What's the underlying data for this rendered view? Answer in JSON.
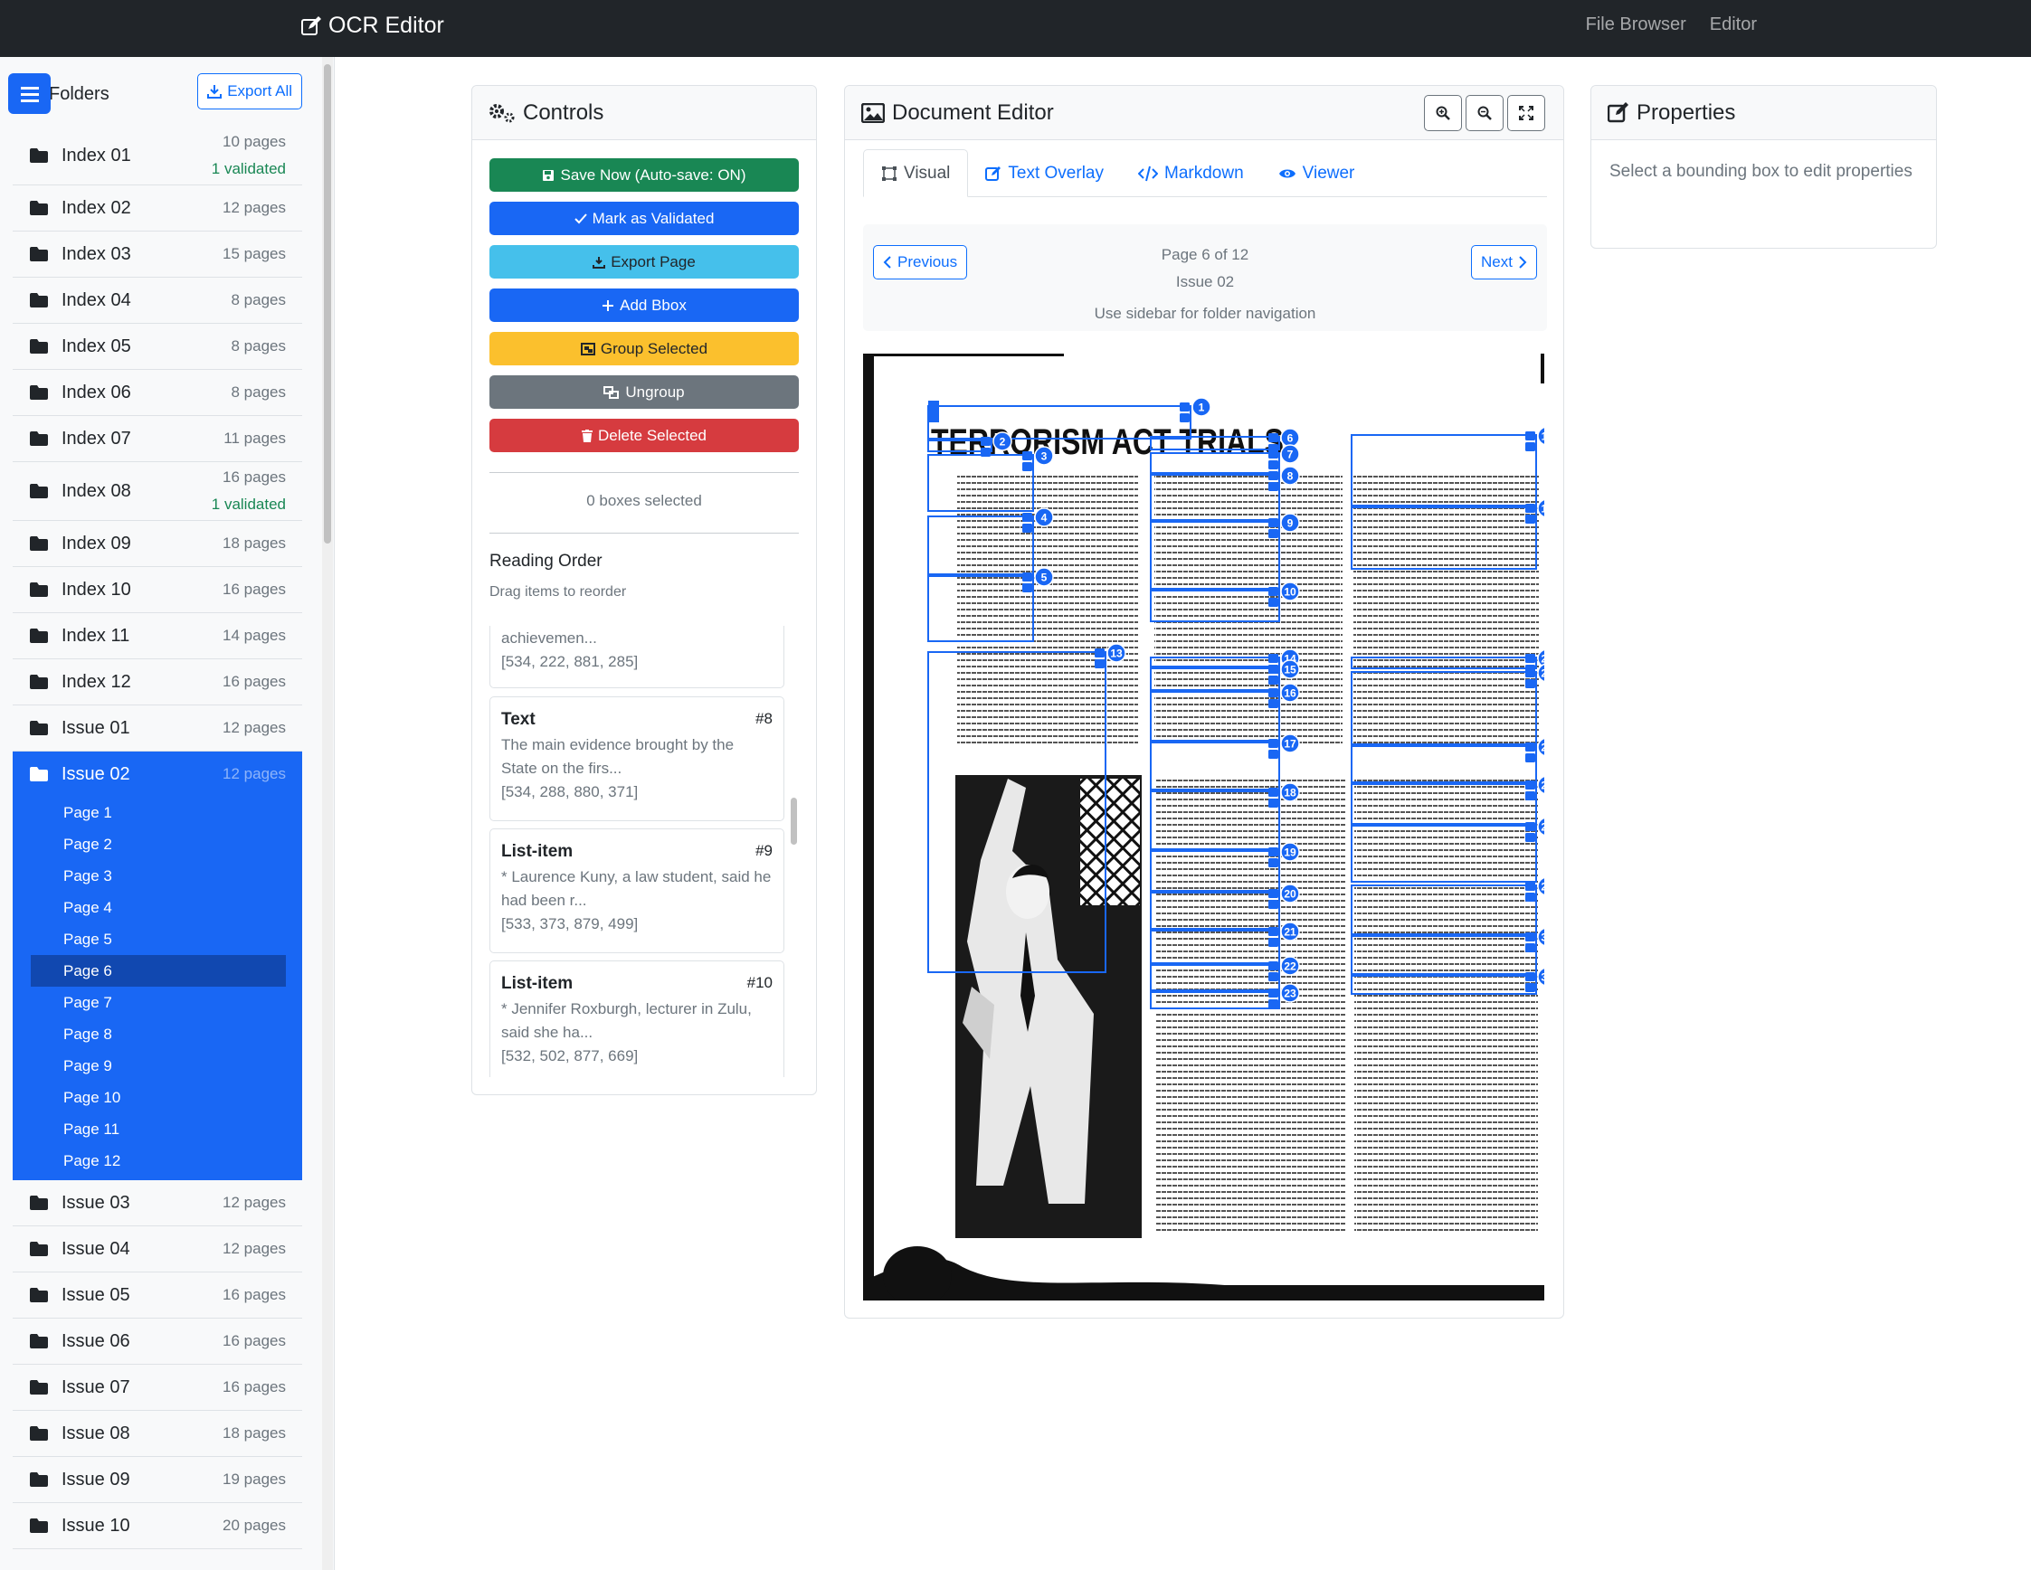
{
  "navbar": {
    "brand": "OCR Editor",
    "links": [
      "File Browser",
      "Editor"
    ]
  },
  "sidebar": {
    "title": "Folders",
    "export_all": "Export All",
    "folders_top": [
      {
        "name": "Index 01",
        "pages": "10 pages",
        "validated": "1 validated"
      },
      {
        "name": "Index 02",
        "pages": "12 pages"
      },
      {
        "name": "Index 03",
        "pages": "15 pages"
      },
      {
        "name": "Index 04",
        "pages": "8 pages"
      },
      {
        "name": "Index 05",
        "pages": "8 pages"
      },
      {
        "name": "Index 06",
        "pages": "8 pages"
      },
      {
        "name": "Index 07",
        "pages": "11 pages"
      },
      {
        "name": "Index 08",
        "pages": "16 pages",
        "validated": "1 validated"
      },
      {
        "name": "Index 09",
        "pages": "18 pages"
      },
      {
        "name": "Index 10",
        "pages": "16 pages"
      },
      {
        "name": "Index 11",
        "pages": "14 pages"
      },
      {
        "name": "Index 12",
        "pages": "16 pages"
      },
      {
        "name": "Issue 01",
        "pages": "12 pages"
      }
    ],
    "active_folder": {
      "name": "Issue 02",
      "pages": "12 pages",
      "page_items": [
        "Page 1",
        "Page 2",
        "Page 3",
        "Page 4",
        "Page 5",
        "Page 6",
        "Page 7",
        "Page 8",
        "Page 9",
        "Page 10",
        "Page 11",
        "Page 12"
      ],
      "selected": "Page 6"
    },
    "folders_bottom": [
      {
        "name": "Issue 03",
        "pages": "12 pages"
      },
      {
        "name": "Issue 04",
        "pages": "12 pages"
      },
      {
        "name": "Issue 05",
        "pages": "16 pages"
      },
      {
        "name": "Issue 06",
        "pages": "16 pages"
      },
      {
        "name": "Issue 07",
        "pages": "16 pages"
      },
      {
        "name": "Issue 08",
        "pages": "18 pages"
      },
      {
        "name": "Issue 09",
        "pages": "19 pages"
      },
      {
        "name": "Issue 10",
        "pages": "20 pages"
      }
    ]
  },
  "controls": {
    "title": "Controls",
    "buttons": {
      "save": "Save Now (Auto-save: ON)",
      "validate": "Mark as Validated",
      "export": "Export Page",
      "add": "Add Bbox",
      "group": "Group Selected",
      "ungroup": "Ungroup",
      "delete": "Delete Selected"
    },
    "colors": {
      "save": "#198754",
      "validate": "#1967f4",
      "export": "#45c0eb",
      "add": "#1967f4",
      "group": "#fbc02d",
      "ungroup": "#6c757d",
      "delete": "#d63b3f"
    },
    "boxes_selected": "0 boxes selected",
    "reading_order_title": "Reading Order",
    "reading_order_sub": "Drag items to reorder",
    "items": [
      {
        "type": "",
        "num": "",
        "text": "which could be of use in furthering the achievemen...",
        "coords": "[534, 222, 881, 285]"
      },
      {
        "type": "Text",
        "num": "#8",
        "text": "The main evidence brought by the State on the firs...",
        "coords": "[534, 288, 880, 371]"
      },
      {
        "type": "List-item",
        "num": "#9",
        "text": "* Laurence Kuny, a law student, said he had been r...",
        "coords": "[533, 373, 879, 499]"
      },
      {
        "type": "List-item",
        "num": "#10",
        "text": "* Jennifer Roxburgh, lecturer in Zulu, said she ha...",
        "coords": "[532, 502, 877, 669]"
      }
    ]
  },
  "editor": {
    "title": "Document Editor",
    "tabs": [
      "Visual",
      "Text Overlay",
      "Markdown",
      "Viewer"
    ],
    "previous": "Previous",
    "next": "Next",
    "page_info": "Page 6 of 12",
    "issue": "Issue 02",
    "hint": "Use sidebar for folder navigation",
    "headline": "TERRORISM ACT TRIALS",
    "accent": "#1967f4"
  },
  "properties": {
    "title": "Properties",
    "hint": "Select a bounding box to edit properties"
  }
}
